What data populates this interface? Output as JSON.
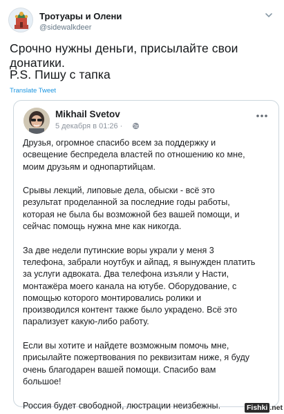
{
  "tweet": {
    "author_name": "Тротуары и Олени",
    "author_handle": "@sidewalkdeer",
    "text_line1": "Срочно нужны деньги, присылайте свои донатики.",
    "text_line2": "P.S. Пишу с тапка",
    "translate_label": "Translate Tweet"
  },
  "quoted_post": {
    "author_name": "Mikhail Svetov",
    "date": "5 декабря в 01:26 ·",
    "paragraphs": [
      [
        "Друзья, огромное спасибо всем за поддержку и",
        "освещение беспредела властей по отношению ко мне,",
        "моим друзьям и однопартийцам."
      ],
      [
        "Срывы лекций, липовые дела, обыски - всё это",
        "результат проделанной за последние годы работы,",
        "которая не была бы возможной без вашей помощи, и",
        "сейчас помощь нужна мне как никогда."
      ],
      [
        "За две недели путинские воры украли у меня 3",
        "телефона, забрали ноутбук и айпад, я вынужден платить",
        "за услуги адвоката. Два телефона изъяли у Насти,",
        "монтажёра моего канала на ютубе. Оборудование, с",
        "помощью которого монтировались ролики и",
        "производился контент также было украдено. Всё это",
        "парализует какую-либо работу."
      ],
      [
        "Если вы хотите и найдете возможным помочь мне,",
        "присылайте пожертвования по реквизитам ниже, я буду",
        "очень благодарен вашей помощи. Спасибо вам",
        "большое!"
      ],
      [
        "Россия будет свободной, люстрации неизбежны."
      ]
    ]
  },
  "watermark": {
    "brand": "Fishki",
    "suffix": ".net"
  },
  "colors": {
    "link": "#1b95e0",
    "secondary_text": "#657786",
    "border": "#ccd6dd"
  },
  "icons": [
    "chevron-down-icon",
    "globe-icon",
    "more-icon"
  ]
}
